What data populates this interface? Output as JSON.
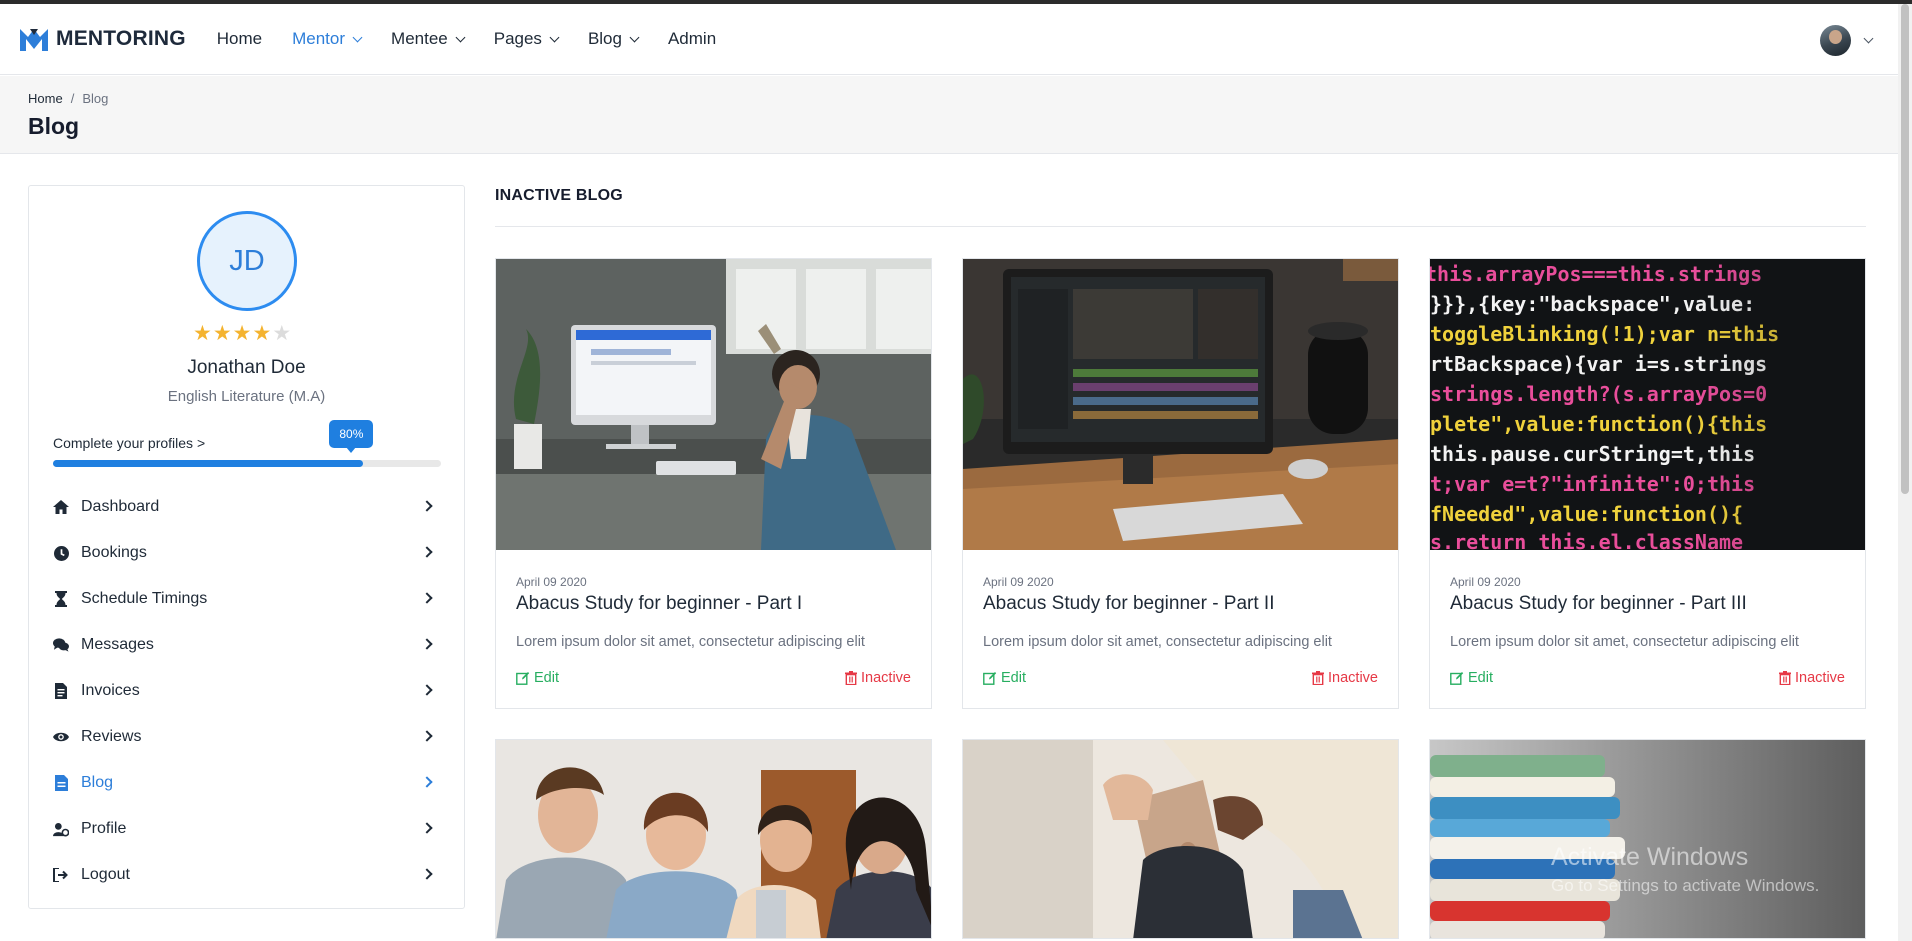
{
  "brand": {
    "name": "MENTORING",
    "accent": "#2d7ed9"
  },
  "nav": {
    "items": [
      {
        "label": "Home",
        "has_dropdown": false,
        "active": false
      },
      {
        "label": "Mentor",
        "has_dropdown": true,
        "active": true
      },
      {
        "label": "Mentee",
        "has_dropdown": true,
        "active": false
      },
      {
        "label": "Pages",
        "has_dropdown": true,
        "active": false
      },
      {
        "label": "Blog",
        "has_dropdown": true,
        "active": false
      },
      {
        "label": "Admin",
        "has_dropdown": false,
        "active": false
      }
    ]
  },
  "breadcrumb": {
    "home": "Home",
    "separator": "/",
    "current": "Blog"
  },
  "page_title": "Blog",
  "profile": {
    "initials": "JD",
    "rating": 4,
    "max_rating": 5,
    "name": "Jonathan Doe",
    "degree": "English Literature (M.A)",
    "complete_label": "Complete your profiles >",
    "progress_percent": 80,
    "progress_label": "80%"
  },
  "sidebar_menu": [
    {
      "label": "Dashboard",
      "icon": "home-icon",
      "active": false
    },
    {
      "label": "Bookings",
      "icon": "clock-icon",
      "active": false
    },
    {
      "label": "Schedule Timings",
      "icon": "hourglass-icon",
      "active": false
    },
    {
      "label": "Messages",
      "icon": "comments-icon",
      "active": false
    },
    {
      "label": "Invoices",
      "icon": "invoice-icon",
      "active": false
    },
    {
      "label": "Reviews",
      "icon": "eye-icon",
      "active": false
    },
    {
      "label": "Blog",
      "icon": "blog-icon",
      "active": true
    },
    {
      "label": "Profile",
      "icon": "user-cog-icon",
      "active": false
    },
    {
      "label": "Logout",
      "icon": "logout-icon",
      "active": false
    }
  ],
  "section_title": "INACTIVE BLOG",
  "blogs": [
    {
      "date": "April 09 2020",
      "title": "Abacus Study for beginner - Part I",
      "description": "Lorem ipsum dolor sit amet, consectetur adipiscing elit",
      "edit_label": "Edit",
      "status_label": "Inactive",
      "image": "man-at-imac-photo"
    },
    {
      "date": "April 09 2020",
      "title": "Abacus Study for beginner - Part II",
      "description": "Lorem ipsum dolor sit amet, consectetur adipiscing elit",
      "edit_label": "Edit",
      "status_label": "Inactive",
      "image": "video-editing-desk-photo"
    },
    {
      "date": "April 09 2020",
      "title": "Abacus Study for beginner - Part III",
      "description": "Lorem ipsum dolor sit amet, consectetur adipiscing elit",
      "edit_label": "Edit",
      "status_label": "Inactive",
      "image": "code-screen-photo"
    },
    {
      "image": "students-group-photo"
    },
    {
      "image": "laptop-backpack-photo"
    },
    {
      "image": "stacked-books-photo"
    }
  ],
  "colors": {
    "edit": "#27ae60",
    "inactive": "#e63946",
    "star": "#f4b32f",
    "progress": "#1f7fe0"
  },
  "watermark": {
    "title": "Activate Windows",
    "subtitle": "Go to Settings to activate Windows."
  }
}
